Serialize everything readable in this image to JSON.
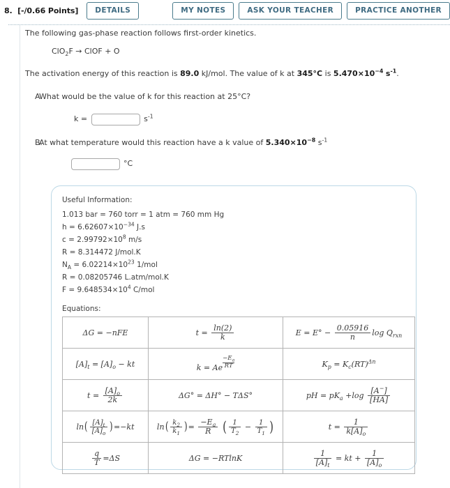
{
  "header": {
    "question_number": "8.",
    "points": "[-/0.66 Points]",
    "details_label": "DETAILS",
    "my_notes_label": "MY NOTES",
    "ask_teacher_label": "ASK YOUR TEACHER",
    "practice_another_label": "PRACTICE ANOTHER"
  },
  "question": {
    "intro": "The following gas-phase reaction follows first-order kinetics.",
    "reaction": {
      "reactant_1": "ClO",
      "reactant_1_sub": "2",
      "reactant_1_tail": "F",
      "arrow": "→",
      "products": "ClOF + O"
    },
    "activation": {
      "pre": "The activation energy of this reaction is ",
      "energy_value": "89.0",
      "mid": " kJ/mol. The value of k at ",
      "temperature": "345°C",
      "mid2": " is ",
      "k_mantissa": "5.470",
      "times": "×",
      "k_base": "10",
      "k_exponent": "−4",
      "unit_s": "s",
      "unit_exp": "-1",
      "period": "."
    },
    "parts": [
      {
        "letter": "A.",
        "text": "What would be the value of k for this reaction at 25°C?",
        "input_prefix": "k =",
        "input_value": "",
        "input_placeholder": "",
        "unit": "s",
        "unit_exponent": "-1"
      },
      {
        "letter": "B.",
        "text_pre": "At what temperature would this reaction have a k value of ",
        "k_mantissa": "5.340",
        "times": "×",
        "k_base": "10",
        "k_exponent": "−8",
        "unit_s": "s",
        "unit_exp": "-1",
        "input_value": "",
        "input_placeholder": "",
        "unit": "°C"
      }
    ]
  },
  "useful_information": {
    "title": "Useful Information:",
    "constants": [
      {
        "text": "1.013 bar = 760 torr = 1 atm = 760 mm Hg"
      },
      {
        "symbol": "h",
        "eq": " = ",
        "mantissa": "6.62607",
        "times": "×",
        "base": "10",
        "exponent": "−34",
        "unit": " J.s"
      },
      {
        "symbol": "c",
        "eq": " = ",
        "mantissa": "2.99792",
        "times": "×",
        "base": "10",
        "exponent": "8",
        "unit": " m/s"
      },
      {
        "symbol": "R",
        "eq": " = ",
        "mantissa": "8.314472",
        "unit": " J/mol.K"
      },
      {
        "symbol": "N",
        "sub": "A",
        "eq": " = ",
        "mantissa": "6.02214",
        "times": "×",
        "base": "10",
        "exponent": "23",
        "unit": " 1/mol"
      },
      {
        "symbol": "R",
        "eq": " = ",
        "mantissa": "0.08205746",
        "unit": " L.atm/mol.K"
      },
      {
        "symbol": "F",
        "eq": " = ",
        "mantissa": "9.648534",
        "times": "×",
        "base": "10",
        "exponent": "4",
        "unit": " C/mol"
      }
    ],
    "equations_label": "Equations:",
    "equations_table": [
      [
        "ΔG = −nFE",
        "t = ln(2) / k",
        "E = E° − (0.05916/n) log Q_rxn"
      ],
      [
        "[A]t = [A]o − kt",
        "k = Ae^(−Ea/RT)",
        "Kp = Kc(RT)^Δn"
      ],
      [
        "t = [A]o / 2k",
        "ΔG° = ΔH° − TΔS°",
        "pH = pKa + log [A−]/[HA]"
      ],
      [
        "ln([A]t/[A]o) = −kt",
        "ln(k2/k1) = (−Ea/R)(1/T2 − 1/T1)",
        "t = 1 / k[A]o"
      ],
      [
        "q/T = ΔS",
        "ΔG = −RTlnK",
        "1/[A]t = kt + 1/[A]o"
      ]
    ]
  }
}
